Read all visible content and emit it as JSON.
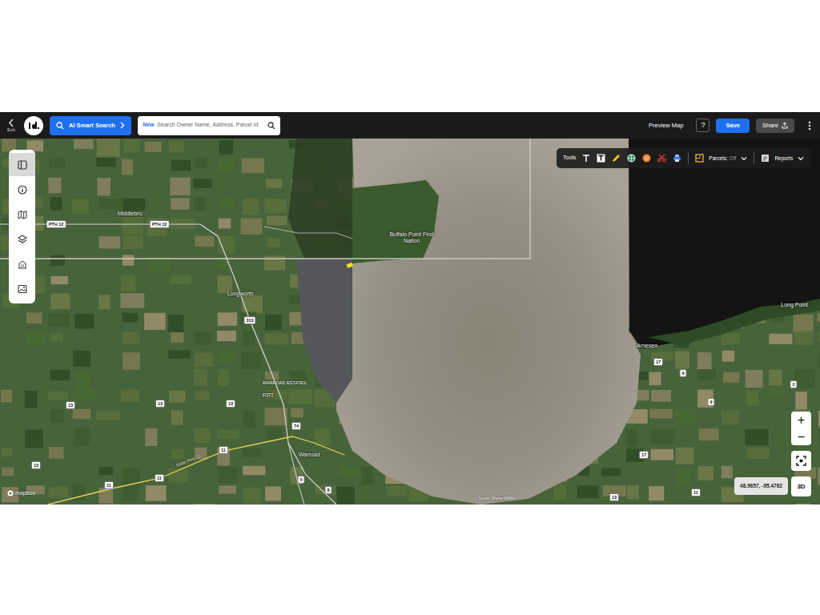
{
  "toolbar": {
    "exit": "Exit",
    "ai_search": "AI Smart Search",
    "search_badge": "New",
    "search_placeholder": "Search Owner Name, Address, Parcel Id",
    "preview": "Preview Map",
    "help": "?",
    "save": "Save",
    "share": "Share"
  },
  "side_tools": [
    {
      "selected": true
    },
    {
      "selected": false
    },
    {
      "selected": false
    },
    {
      "selected": false
    },
    {
      "selected": false
    },
    {
      "selected": false
    }
  ],
  "tools_bar": {
    "label": "Tools",
    "parcels_label": "Parcels:",
    "parcels_state": "Off",
    "reports": "Reports"
  },
  "map": {
    "labels": [
      {
        "text": "Middlebro",
        "kind": "place"
      },
      {
        "text": "PTH 12",
        "kind": "shield"
      },
      {
        "text": "PTH 12",
        "kind": "shield"
      },
      {
        "text": "Buffalo Point First Nation",
        "kind": "place"
      },
      {
        "text": "Longworth",
        "kind": "place"
      },
      {
        "text": "313",
        "kind": "shield"
      },
      {
        "text": "WARROAD ESTATES",
        "kind": "small"
      },
      {
        "text": "RRT",
        "kind": "place"
      },
      {
        "text": "74",
        "kind": "shield"
      },
      {
        "text": "11",
        "kind": "shield"
      },
      {
        "text": "Warroad",
        "kind": "place"
      },
      {
        "text": "11",
        "kind": "shield"
      },
      {
        "text": "11",
        "kind": "shield"
      },
      {
        "text": "13",
        "kind": "shield"
      },
      {
        "text": "13",
        "kind": "shield"
      },
      {
        "text": "13",
        "kind": "shield"
      },
      {
        "text": "13",
        "kind": "shield"
      },
      {
        "text": "5",
        "kind": "shield"
      },
      {
        "text": "8",
        "kind": "shield"
      },
      {
        "text": "Arnesen",
        "kind": "place"
      },
      {
        "text": "Long Point",
        "kind": "place"
      },
      {
        "text": "17",
        "kind": "shield"
      },
      {
        "text": "9",
        "kind": "shield"
      },
      {
        "text": "9",
        "kind": "shield"
      },
      {
        "text": "2",
        "kind": "shield"
      },
      {
        "text": "17",
        "kind": "shield"
      },
      {
        "text": "13",
        "kind": "shield"
      },
      {
        "text": "11",
        "kind": "shield"
      },
      {
        "text": "South Shore WMA",
        "kind": "small"
      },
      {
        "text": "State Hwy 11",
        "kind": "road"
      }
    ],
    "attribution": "mapbox",
    "coordinates": "48.9657, -95.4762"
  },
  "zoom": {
    "in": "+",
    "out": "−",
    "mode": "3D"
  }
}
